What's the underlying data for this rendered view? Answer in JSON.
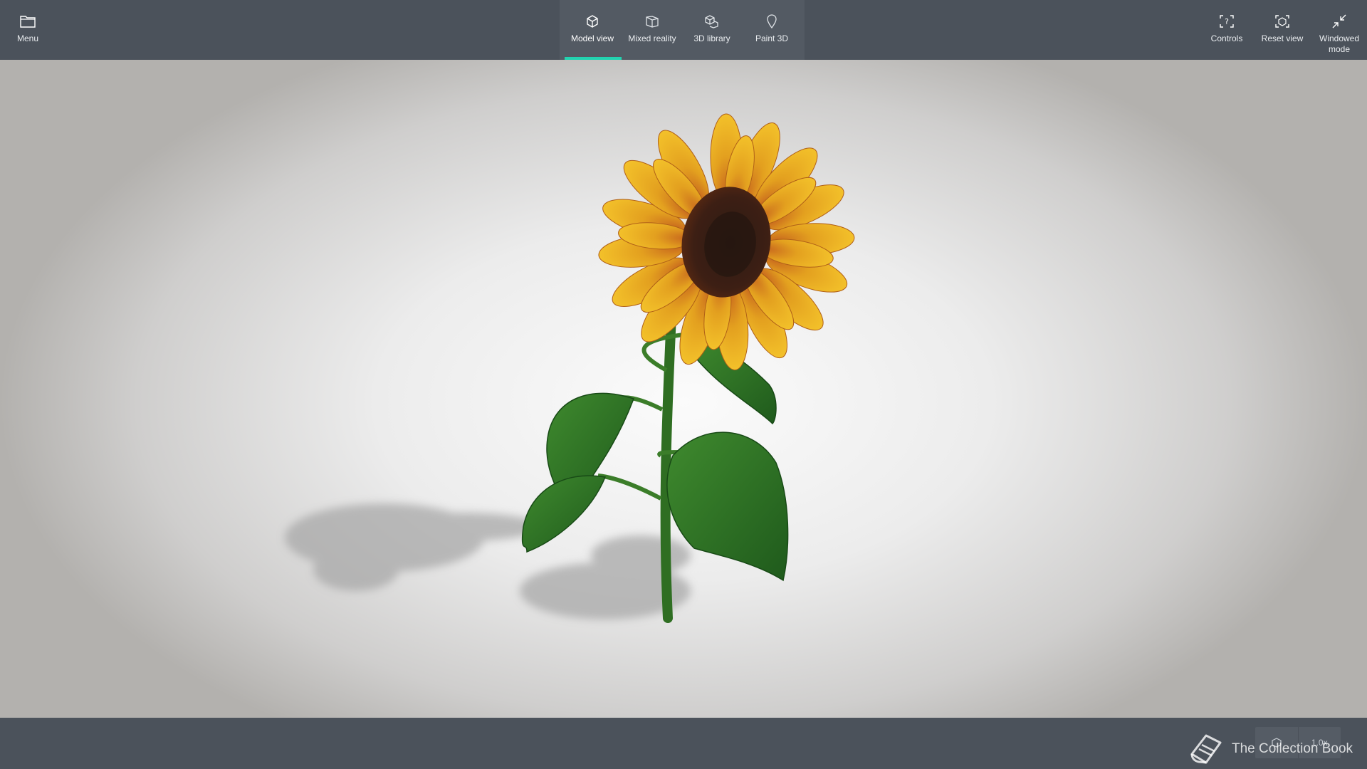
{
  "topbar": {
    "menu": {
      "label": "Menu",
      "icon": "folder-icon"
    },
    "tabs": [
      {
        "label": "Model view",
        "icon": "cube-icon",
        "active": true
      },
      {
        "label": "Mixed reality",
        "icon": "mixed-reality-icon",
        "active": false
      },
      {
        "label": "3D library",
        "icon": "library-icon",
        "active": false
      },
      {
        "label": "Paint 3D",
        "icon": "paint-pin-icon",
        "active": false
      }
    ],
    "controls": {
      "label": "Controls",
      "icon": "controls-icon"
    },
    "reset_view": {
      "label": "Reset view",
      "icon": "reset-view-icon"
    },
    "windowed_mode": {
      "label": "Windowed\nmode",
      "icon": "collapse-arrows-icon"
    }
  },
  "status": {
    "zoom_label": "1.0x"
  },
  "watermark": {
    "text": "The Collection Book"
  },
  "colors": {
    "bar_background": "#4b525b",
    "tab_group_background": "#535a63",
    "active_tab_accent": "#22d3b0"
  }
}
